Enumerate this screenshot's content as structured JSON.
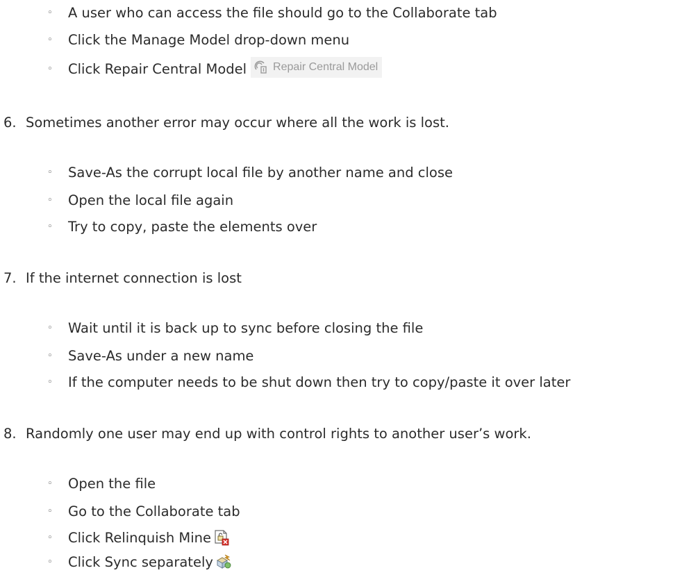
{
  "section_5_items": [
    "A user who can access the file should go to the Collaborate tab",
    "Click the Manage Model drop-down menu",
    "Click Repair Central Model"
  ],
  "repair_button_label": "Repair Central Model",
  "step_6": {
    "num": "6.",
    "text": "Sometimes another error may occur where all the work is lost."
  },
  "step_6_items": [
    "Save-As the corrupt local file by another name and close",
    "Open the local file again",
    "Try to copy, paste the elements over"
  ],
  "step_7": {
    "num": "7.",
    "text": "If the internet connection is lost"
  },
  "step_7_items": [
    "Wait until it is back up to sync before closing the file",
    "Save-As under a new name",
    "If the computer needs to be shut down then try to copy/paste it over later"
  ],
  "step_8": {
    "num": "8.",
    "text": "Randomly one user may end up with control rights to another user’s work."
  },
  "step_8_items": [
    "Open the file",
    "Go to the Collaborate tab",
    "Click Relinquish Mine",
    "Click Sync separately"
  ],
  "bullet_glyph": "◦",
  "icons": {
    "repair": "repair-central-model-icon",
    "relinquish": "relinquish-mine-icon",
    "sync": "sync-icon"
  }
}
